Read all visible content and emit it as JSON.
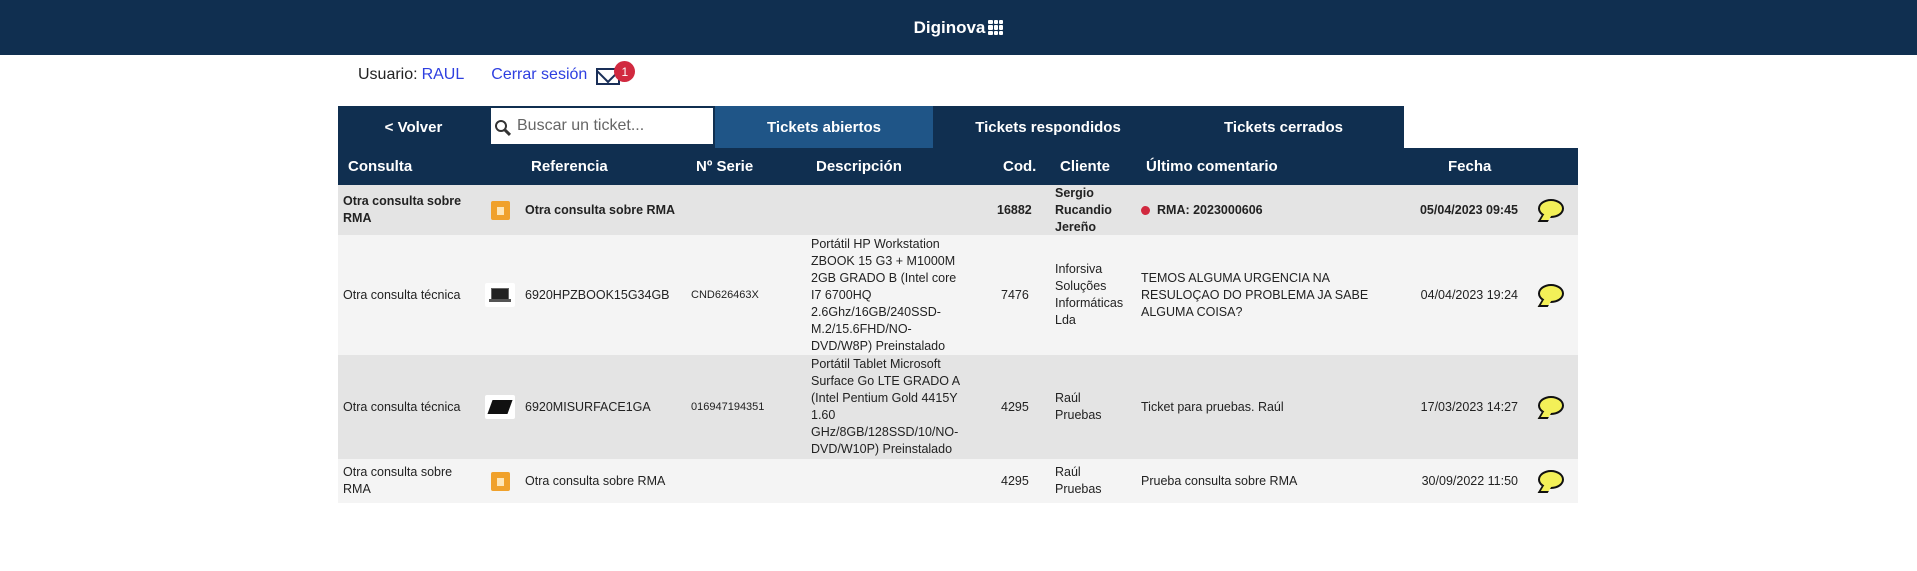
{
  "header": {
    "brand": "Diginova"
  },
  "user": {
    "label": "Usuario:",
    "name": "RAUL",
    "logout": "Cerrar sesión",
    "mail_count": "1"
  },
  "tabs": {
    "back": "< Volver",
    "search_placeholder": "Buscar un ticket...",
    "open": "Tickets abiertos",
    "answered": "Tickets respondidos",
    "closed": "Tickets cerrados"
  },
  "columns": {
    "consulta": "Consulta",
    "referencia": "Referencia",
    "serie": "Nº Serie",
    "descripcion": "Descripción",
    "cod": "Cod.",
    "cliente": "Cliente",
    "comentario": "Último comentario",
    "fecha": "Fecha"
  },
  "rows": [
    {
      "consulta": "Otra consulta sobre RMA",
      "icon": "box-icon",
      "referencia": "Otra consulta sobre RMA",
      "serie": "",
      "descripcion": "",
      "cod": "16882",
      "cliente": "Sergio Rucandio Jereño",
      "comentario": "RMA: 2023000606",
      "fecha": "05/04/2023 09:45"
    },
    {
      "consulta": "Otra consulta técnica",
      "icon": "laptop-icon",
      "referencia": "6920HPZBOOK15G34GB",
      "serie": "CND626463X",
      "descripcion": "Portátil HP Workstation ZBOOK 15 G3 + M1000M 2GB GRADO B (Intel core I7 6700HQ 2.6Ghz/16GB/240SSD-M.2/15.6FHD/NO-DVD/W8P) Preinstalado",
      "cod": "7476",
      "cliente": "Inforsiva Soluções Informáticas Lda",
      "comentario": "TEMOS ALGUMA URGENCIA NA RESULOÇAO DO PROBLEMA JA SABE ALGUMA COISA?",
      "fecha": "04/04/2023 19:24"
    },
    {
      "consulta": "Otra consulta técnica",
      "icon": "tablet-icon",
      "referencia": "6920MISURFACE1GA",
      "serie": "016947194351",
      "descripcion": "Portátil Tablet Microsoft Surface Go LTE GRADO A (Intel Pentium Gold 4415Y 1.60 GHz/8GB/128SSD/10/NO-DVD/W10P) Preinstalado",
      "cod": "4295",
      "cliente": "Raúl Pruebas",
      "comentario": "Ticket para pruebas. Raúl",
      "fecha": "17/03/2023 14:27"
    },
    {
      "consulta": "Otra consulta sobre RMA",
      "icon": "box-icon",
      "referencia": "Otra consulta sobre RMA",
      "serie": "",
      "descripcion": "",
      "cod": "4295",
      "cliente": "Raúl Pruebas",
      "comentario": "Prueba consulta sobre RMA",
      "fecha": "30/09/2022 11:50"
    }
  ]
}
